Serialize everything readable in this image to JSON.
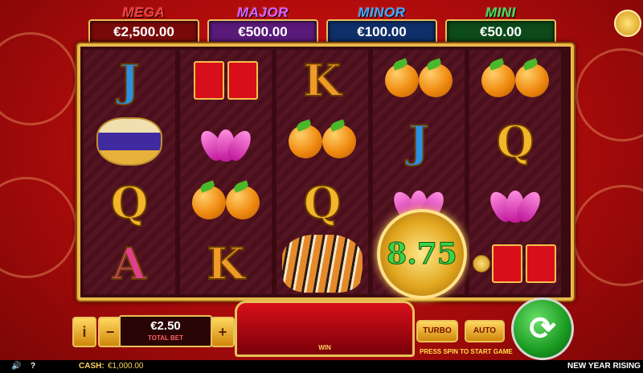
{
  "jackpots": [
    {
      "label": "MEGA",
      "amount": "€2,500.00",
      "label_color": "#ff3c3c",
      "box_color": "#7a0a0a"
    },
    {
      "label": "MAJOR",
      "amount": "€500.00",
      "label_color": "#e05cff",
      "box_color": "#5a1a7a"
    },
    {
      "label": "MINOR",
      "amount": "€100.00",
      "label_color": "#46a6ff",
      "box_color": "#0f2f6a"
    },
    {
      "label": "MINI",
      "amount": "€50.00",
      "label_color": "#46e05a",
      "box_color": "#0c4a1a"
    }
  ],
  "gift_icon": "gift-icon",
  "reels": [
    [
      "J",
      "drum",
      "Q",
      "A"
    ],
    [
      "envelopes",
      "lotus",
      "oranges",
      "K"
    ],
    [
      "K",
      "oranges",
      "Q",
      "tiger"
    ],
    [
      "oranges",
      "J",
      "lotus",
      "bonus"
    ],
    [
      "oranges",
      "Q",
      "lotus",
      "envelopes"
    ]
  ],
  "bonus_value": "8.75",
  "controls": {
    "info": "i",
    "minus": "−",
    "plus": "+",
    "bet_value": "€2.50",
    "bet_label": "TOTAL BET",
    "win_label": "WIN",
    "turbo": "TURBO",
    "auto": "AUTO",
    "hint": "PRESS SPIN TO START GAME"
  },
  "statusbar": {
    "sound_icon": "speaker-icon",
    "help": "?",
    "cash_label": "CASH:",
    "cash_value": "€1,000.00",
    "game_title": "NEW YEAR RISING"
  }
}
